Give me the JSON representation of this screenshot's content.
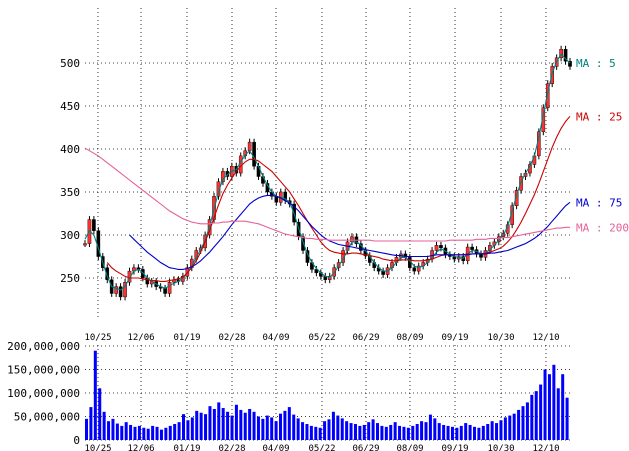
{
  "chart_data": [
    {
      "type": "line",
      "panel": "price",
      "y_ticks": [
        250,
        300,
        350,
        400,
        450,
        500
      ],
      "ylim": [
        215,
        540
      ],
      "grid": true,
      "x_labels": [
        "10/25",
        "12/06",
        "01/19",
        "02/28",
        "04/09",
        "05/22",
        "06/29",
        "08/09",
        "09/19",
        "10/30",
        "12/10"
      ],
      "candles_close": [
        290,
        318,
        305,
        275,
        262,
        248,
        232,
        240,
        228,
        245,
        258,
        262,
        260,
        250,
        243,
        246,
        240,
        238,
        232,
        245,
        248,
        246,
        252,
        262,
        272,
        282,
        285,
        300,
        318,
        345,
        362,
        374,
        368,
        380,
        372,
        392,
        398,
        408,
        380,
        368,
        360,
        350,
        345,
        338,
        350,
        340,
        336,
        315,
        298,
        282,
        268,
        260,
        256,
        252,
        248,
        252,
        262,
        268,
        282,
        292,
        298,
        290,
        282,
        276,
        268,
        262,
        258,
        254,
        262,
        268,
        274,
        278,
        274,
        262,
        258,
        264,
        268,
        272,
        282,
        288,
        285,
        277,
        275,
        272,
        275,
        270,
        286,
        283,
        278,
        274,
        282,
        288,
        292,
        298,
        302,
        312,
        334,
        352,
        368,
        372,
        382,
        392,
        420,
        448,
        476,
        496,
        506,
        516,
        502,
        496
      ],
      "series": [
        {
          "name": "MA : 5",
          "color": "#008080",
          "values": [
            295,
            305,
            300,
            285,
            268,
            252,
            240,
            238,
            236,
            240,
            250,
            258,
            260,
            256,
            250,
            246,
            243,
            240,
            238,
            241,
            244,
            246,
            250,
            256,
            264,
            274,
            283,
            294,
            310,
            330,
            350,
            365,
            370,
            374,
            376,
            385,
            393,
            398,
            390,
            380,
            368,
            358,
            350,
            345,
            344,
            342,
            338,
            325,
            308,
            292,
            278,
            268,
            261,
            256,
            252,
            251,
            256,
            264,
            272,
            282,
            292,
            292,
            288,
            282,
            275,
            268,
            262,
            258,
            258,
            262,
            268,
            274,
            274,
            270,
            264,
            262,
            264,
            268,
            274,
            280,
            284,
            281,
            278,
            275,
            274,
            273,
            278,
            282,
            281,
            278,
            279,
            283,
            288,
            294,
            300,
            310,
            328,
            346,
            362,
            372,
            380,
            392,
            414,
            440,
            466,
            488,
            502,
            510,
            505,
            500
          ]
        },
        {
          "name": "MA : 25",
          "color": "#cc0000",
          "values": [
            null,
            null,
            null,
            null,
            null,
            268,
            262,
            258,
            255,
            252,
            250,
            250,
            250,
            249,
            248,
            247,
            247,
            246,
            246,
            247,
            248,
            249,
            251,
            256,
            262,
            270,
            280,
            292,
            305,
            320,
            335,
            348,
            358,
            366,
            374,
            380,
            385,
            388,
            388,
            386,
            382,
            378,
            374,
            368,
            362,
            356,
            350,
            342,
            334,
            325,
            316,
            308,
            300,
            292,
            286,
            282,
            280,
            279,
            278,
            278,
            279,
            279,
            278,
            277,
            276,
            275,
            274,
            272,
            271,
            270,
            270,
            271,
            271,
            271,
            270,
            270,
            270,
            271,
            272,
            274,
            276,
            277,
            277,
            277,
            277,
            277,
            278,
            278,
            278,
            278,
            279,
            280,
            282,
            284,
            287,
            292,
            298,
            306,
            315,
            325,
            336,
            347,
            360,
            374,
            388,
            402,
            414,
            424,
            432,
            438
          ]
        },
        {
          "name": "MA : 75",
          "color": "#0000cc",
          "values": [
            null,
            null,
            null,
            null,
            null,
            null,
            null,
            null,
            null,
            null,
            300,
            295,
            290,
            285,
            280,
            276,
            272,
            268,
            265,
            262,
            261,
            260,
            260,
            261,
            263,
            266,
            270,
            275,
            280,
            286,
            292,
            298,
            305,
            312,
            318,
            324,
            330,
            336,
            340,
            343,
            345,
            346,
            346,
            345,
            343,
            340,
            337,
            333,
            328,
            322,
            316,
            310,
            305,
            300,
            296,
            293,
            291,
            289,
            288,
            287,
            286,
            285,
            284,
            283,
            282,
            281,
            280,
            279,
            278,
            277,
            276,
            276,
            275,
            275,
            275,
            275,
            275,
            275,
            276,
            277,
            277,
            277,
            277,
            277,
            277,
            277,
            277,
            278,
            278,
            278,
            278,
            279,
            279,
            280,
            281,
            282,
            284,
            286,
            288,
            290,
            293,
            296,
            300,
            305,
            310,
            316,
            322,
            328,
            334,
            338
          ]
        },
        {
          "name": "MA : 200",
          "color": "#e6609a",
          "values": [
            401,
            398,
            395,
            392,
            388,
            384,
            380,
            376,
            372,
            368,
            364,
            360,
            356,
            352,
            348,
            344,
            340,
            336,
            332,
            328,
            325,
            322,
            319,
            317,
            315,
            314,
            313,
            313,
            313,
            314,
            314,
            315,
            315,
            316,
            316,
            316,
            316,
            315,
            314,
            313,
            311,
            309,
            307,
            305,
            303,
            301,
            300,
            299,
            298,
            297,
            296,
            296,
            295,
            295,
            295,
            294,
            294,
            294,
            294,
            294,
            294,
            294,
            294,
            294,
            294,
            293,
            293,
            293,
            293,
            293,
            293,
            293,
            293,
            293,
            293,
            293,
            293,
            293,
            293,
            293,
            293,
            293,
            294,
            294,
            294,
            294,
            294,
            294,
            295,
            295,
            295,
            296,
            296,
            296,
            297,
            297,
            298,
            299,
            300,
            301,
            302,
            303,
            304,
            305,
            306,
            307,
            308,
            308,
            309,
            309
          ]
        }
      ]
    },
    {
      "type": "bar",
      "panel": "volume",
      "y_ticks": [
        0,
        50000000,
        100000000,
        150000000,
        200000000
      ],
      "y_tick_labels": [
        "0",
        "50,000,000",
        "100,000,000",
        "150,000,000",
        "200,000,000"
      ],
      "ylim": [
        0,
        200000000
      ],
      "bar_color": "#0000ff",
      "x_labels": [
        "10/25",
        "12/06",
        "01/19",
        "02/28",
        "04/09",
        "05/22",
        "06/29",
        "08/09",
        "09/19",
        "10/30",
        "12/10"
      ],
      "values": [
        45000000,
        70000000,
        190000000,
        110000000,
        60000000,
        40000000,
        45000000,
        35000000,
        30000000,
        38000000,
        32000000,
        28000000,
        30000000,
        26000000,
        24000000,
        30000000,
        28000000,
        22000000,
        26000000,
        30000000,
        34000000,
        38000000,
        55000000,
        42000000,
        48000000,
        62000000,
        58000000,
        55000000,
        72000000,
        66000000,
        80000000,
        68000000,
        60000000,
        52000000,
        75000000,
        64000000,
        58000000,
        66000000,
        60000000,
        50000000,
        45000000,
        52000000,
        48000000,
        40000000,
        56000000,
        62000000,
        70000000,
        54000000,
        46000000,
        38000000,
        34000000,
        30000000,
        28000000,
        26000000,
        40000000,
        44000000,
        60000000,
        52000000,
        46000000,
        40000000,
        36000000,
        34000000,
        30000000,
        32000000,
        38000000,
        44000000,
        36000000,
        30000000,
        28000000,
        32000000,
        38000000,
        30000000,
        28000000,
        26000000,
        30000000,
        34000000,
        40000000,
        38000000,
        54000000,
        46000000,
        36000000,
        32000000,
        30000000,
        28000000,
        26000000,
        30000000,
        36000000,
        32000000,
        28000000,
        26000000,
        30000000,
        34000000,
        40000000,
        36000000,
        42000000,
        48000000,
        52000000,
        56000000,
        64000000,
        72000000,
        80000000,
        96000000,
        104000000,
        118000000,
        150000000,
        140000000,
        160000000,
        110000000,
        140000000,
        90000000
      ]
    }
  ],
  "ma_labels": [
    {
      "text": "MA : 5",
      "color": "#008080"
    },
    {
      "text": "MA : 25",
      "color": "#cc0000"
    },
    {
      "text": "MA : 75",
      "color": "#0000cc"
    },
    {
      "text": "MA : 200",
      "color": "#e6609a"
    }
  ]
}
